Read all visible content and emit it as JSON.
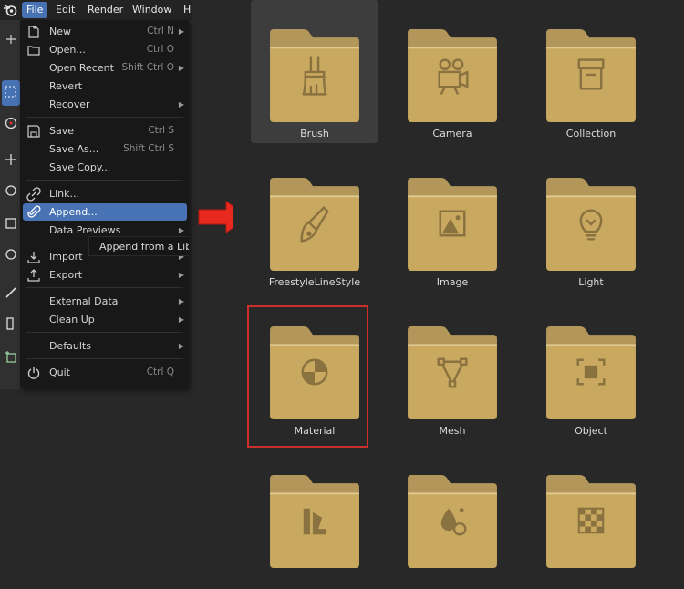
{
  "menubar": {
    "items": [
      "File",
      "Edit",
      "Render",
      "Window",
      "H"
    ]
  },
  "file_menu": {
    "items": [
      {
        "label": "New",
        "shortcut": "Ctrl N",
        "submenu": true,
        "icon": "new-file-icon"
      },
      {
        "label": "Open...",
        "shortcut": "Ctrl O",
        "icon": "folder-open-icon"
      },
      {
        "label": "Open Recent",
        "shortcut": "Shift Ctrl O",
        "submenu": true
      },
      {
        "label": "Revert"
      },
      {
        "label": "Recover",
        "submenu": true
      },
      {
        "label": "Save",
        "shortcut": "Ctrl S",
        "icon": "save-icon"
      },
      {
        "label": "Save As...",
        "shortcut": "Shift Ctrl S"
      },
      {
        "label": "Save Copy..."
      },
      {
        "label": "Link...",
        "icon": "link-icon"
      },
      {
        "label": "Append...",
        "highlighted": true,
        "icon": "append-icon"
      },
      {
        "label": "Data Previews",
        "submenu": true
      },
      {
        "label": "Import",
        "submenu": true,
        "icon": "import-icon"
      },
      {
        "label": "Export",
        "submenu": true,
        "icon": "export-icon"
      },
      {
        "label": "External Data",
        "submenu": true
      },
      {
        "label": "Clean Up",
        "submenu": true
      },
      {
        "label": "Defaults",
        "submenu": true
      },
      {
        "label": "Quit",
        "shortcut": "Ctrl Q",
        "icon": "power-icon"
      }
    ]
  },
  "tooltip": {
    "text": "Append from a Library"
  },
  "browser": {
    "tiles": [
      {
        "name": "Brush",
        "icon": "brush-icon",
        "selected": true
      },
      {
        "name": "Camera",
        "icon": "camera-icon"
      },
      {
        "name": "Collection",
        "icon": "collection-icon"
      },
      {
        "name": "FreestyleLineStyle",
        "icon": "linestyle-icon"
      },
      {
        "name": "Image",
        "icon": "image-icon"
      },
      {
        "name": "Light",
        "icon": "light-icon"
      },
      {
        "name": "Material",
        "icon": "material-icon",
        "highlighted": true
      },
      {
        "name": "Mesh",
        "icon": "mesh-icon"
      },
      {
        "name": "Object",
        "icon": "object-icon"
      },
      {
        "name": "",
        "icon": "palette-icon"
      },
      {
        "name": "",
        "icon": "particles-icon"
      },
      {
        "name": "",
        "icon": "texture-icon"
      }
    ]
  },
  "colors": {
    "accent": "#4772b3",
    "folder": "#c9a95f",
    "folder_tab": "#b2965a",
    "folder_glyph": "#8a7240",
    "arrow": "#e8291f",
    "highlight_box": "#c9302c"
  }
}
